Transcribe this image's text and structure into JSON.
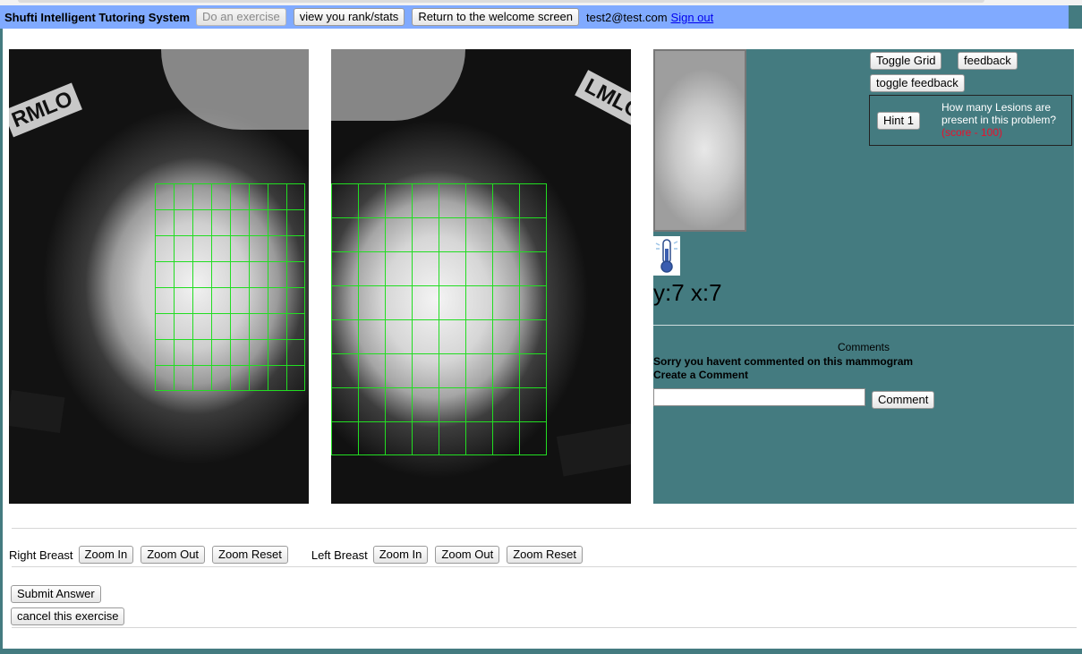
{
  "header": {
    "brand": "Shufti Intelligent Tutoring System",
    "do_exercise": "Do an exercise",
    "rank_stats": "view you rank/stats",
    "return_welcome": "Return to the welcome screen",
    "user_email": "test2@test.com",
    "sign_out": "Sign out"
  },
  "images": {
    "right_tag": "RMLO",
    "left_tag": "LMLO"
  },
  "side": {
    "toggle_grid": "Toggle Grid",
    "feedback": "feedback",
    "toggle_feedback": "toggle feedback",
    "hint_button": "Hint 1",
    "hint_question": "How many Lesions are present in this problem?",
    "hint_score": "(score - 100)",
    "coords": "y:7 x:7",
    "comments_title": "Comments",
    "no_comment_msg": "Sorry you havent commented on this mammogram",
    "create_comment": "Create a Comment",
    "comment_placeholder": "",
    "comment_button": "Comment"
  },
  "zoom": {
    "right_label": "Right Breast",
    "left_label": "Left Breast",
    "zoom_in": "Zoom In",
    "zoom_out": "Zoom Out",
    "zoom_reset": "Zoom Reset"
  },
  "actions": {
    "submit": "Submit Answer",
    "cancel": "cancel this exercise"
  },
  "colors": {
    "header_bg": "#80aaff",
    "panel_bg": "#447b80",
    "grid_line": "#22dd22",
    "score_text": "#e8112d"
  }
}
